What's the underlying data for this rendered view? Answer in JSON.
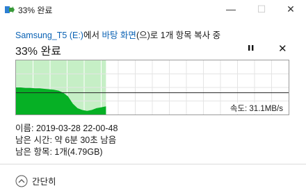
{
  "window": {
    "title": "33% 완료",
    "minimize_glyph": "—",
    "maximize_glyph": "☐",
    "close_glyph": "✕"
  },
  "copy": {
    "source_name": "Samsung_T5 (E:)",
    "text_from": "에서 ",
    "dest_name": "바탕 화면",
    "text_to": "(으)로 1개 항목 복사 중",
    "percent_label": "33% 완료",
    "progress_fraction": 0.33,
    "stop_glyph": "✕"
  },
  "graph": {
    "speed_label": "속도: 31.1MB/s",
    "progress_color": "#c6efc6",
    "speed_color": "#06b025",
    "line_color": "#222222",
    "speed_history": [
      30,
      30,
      29.5,
      29.5,
      29,
      29,
      28.5,
      28,
      27.5,
      26.5,
      24,
      20,
      12,
      7,
      5,
      4,
      5,
      7,
      8,
      9
    ]
  },
  "details": {
    "name": "이름: 2019-03-28 22-00-48",
    "time_left": "남은 시간: 약 6분 30초 남음",
    "items_left": "남은 항목: 1개(4.79GB)"
  },
  "footer": {
    "collapse_label": "간단히"
  },
  "colors": {
    "accent": "#0a62b4",
    "icon_blue": "#2d7fd3",
    "icon_green": "#3a9a3a"
  }
}
